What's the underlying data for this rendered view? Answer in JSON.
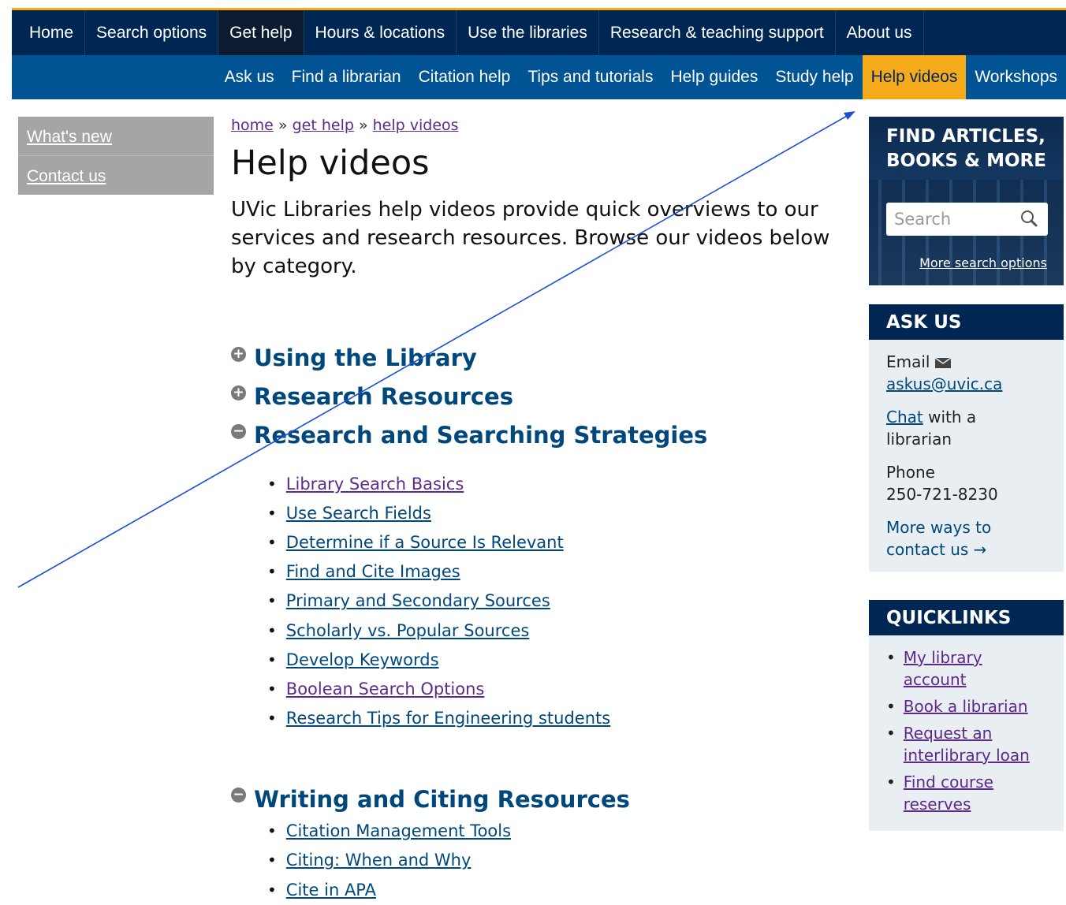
{
  "topnav": [
    "Home",
    "Search options",
    "Get help",
    "Hours & locations",
    "Use the libraries",
    "Research & teaching support",
    "About us"
  ],
  "subnav": [
    "Ask us",
    "Find a librarian",
    "Citation help",
    "Tips and tutorials",
    "Help guides",
    "Study help",
    "Help videos",
    "Workshops"
  ],
  "leftnav": [
    "What's new",
    "Contact us"
  ],
  "breadcrumb": {
    "home": "home",
    "sep1": " » ",
    "get_help": "get help",
    "sep2": " » ",
    "current": "help videos"
  },
  "page_title": "Help videos",
  "intro": "UVic Libraries help videos provide quick overviews to our services and research resources. Browse our videos below by category.",
  "sections": [
    {
      "title": "Using the Library",
      "toggle": "+"
    },
    {
      "title": "Research Resources",
      "toggle": "+"
    },
    {
      "title": "Research and Searching Strategies",
      "toggle": "−",
      "items": [
        "Library Search Basics",
        "Use Search Fields",
        "Determine if a Source Is Relevant",
        "Find and Cite Images",
        "Primary and Secondary Sources",
        "Scholarly vs. Popular Sources",
        "Develop Keywords",
        "Boolean Search Options",
        "Research Tips for Engineering students"
      ]
    },
    {
      "title": "Writing and Citing Resources",
      "toggle": "−",
      "items": [
        "Citation Management Tools",
        "Citing: When and Why",
        "Cite in APA"
      ]
    }
  ],
  "find_box": {
    "title_line1": "FIND ARTICLES,",
    "title_line2": "BOOKS & MORE",
    "search_placeholder": "Search",
    "more_search": "More search options"
  },
  "ask_us": {
    "title": "ASK US",
    "email_label": "Email",
    "email": "askus@uvic.ca",
    "chat_link": "Chat",
    "chat_rest": " with a librarian",
    "phone_label": "Phone",
    "phone": "250-721-8230",
    "more_ways": "More ways to contact us →"
  },
  "quicklinks": {
    "title": "QUICKLINKS",
    "items": [
      "My library account",
      "Book a librarian",
      "Request an interlibrary loan",
      "Find course reserves"
    ]
  },
  "colors": {
    "nav_dark": "#002754",
    "nav_blue": "#005493",
    "accent": "#f5aa1c",
    "link": "#00487c",
    "visited": "#5d2a8c",
    "annotation": "#1f4fd8"
  }
}
